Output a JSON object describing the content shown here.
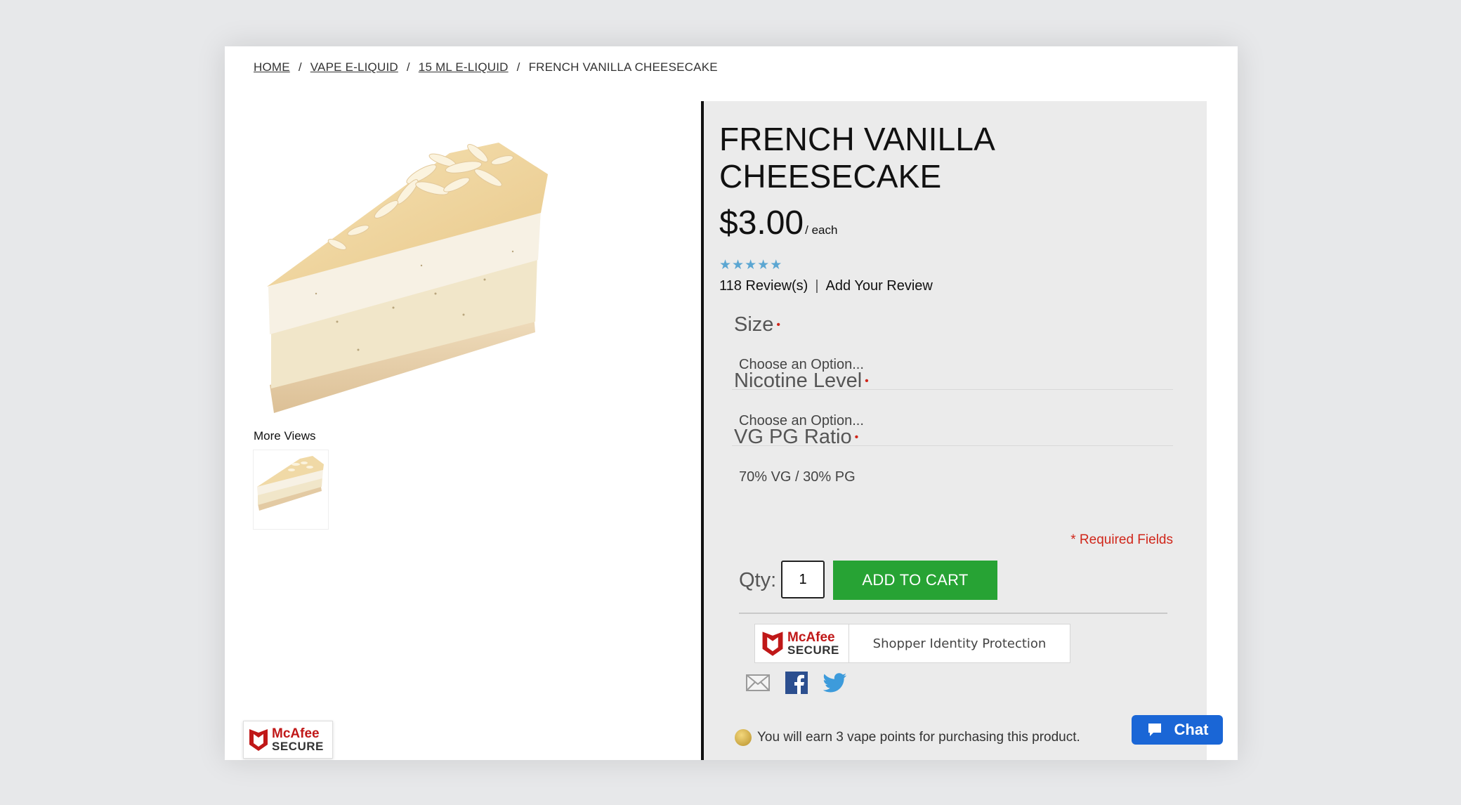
{
  "breadcrumb": {
    "items": [
      "HOME",
      "VAPE E-LIQUID",
      "15 ML E-LIQUID"
    ],
    "separator": "/",
    "current": "FRENCH VANILLA CHEESECAKE"
  },
  "gallery": {
    "more_views_label": "More Views"
  },
  "product": {
    "title": "FRENCH VANILLA CHEESECAKE",
    "price": "$3.00",
    "price_unit": "/ each",
    "rating_stars": 5,
    "reviews_count_label": "118 Review(s)",
    "review_divider": "|",
    "add_review_label": "Add Your Review"
  },
  "options": {
    "required_marker": "•",
    "size": {
      "label": "Size",
      "value": "Choose an Option..."
    },
    "nicotine": {
      "label": "Nicotine Level",
      "value": "Choose an Option..."
    },
    "vgpg": {
      "label": "VG PG Ratio",
      "value": "70% VG / 30% PG"
    },
    "required_fields_text": "* Required Fields"
  },
  "cart": {
    "qty_label": "Qty:",
    "qty_value": "1",
    "add_to_cart_label": "ADD TO CART"
  },
  "trust": {
    "mcafee_line1": "McAfee",
    "mcafee_line2": "SECURE",
    "protection_text": "Shopper Identity Protection"
  },
  "share": {
    "icons": [
      "email-icon",
      "facebook-icon",
      "twitter-icon"
    ]
  },
  "rewards": {
    "points_text": "You will earn 3 vape points for purchasing this product."
  },
  "chat": {
    "label": "Chat"
  },
  "colors": {
    "accent_green": "#27a334",
    "required_red": "#d0261a",
    "star_blue": "#5ba6d2",
    "chat_blue": "#1a66d6",
    "mcafee_red": "#c01818"
  }
}
